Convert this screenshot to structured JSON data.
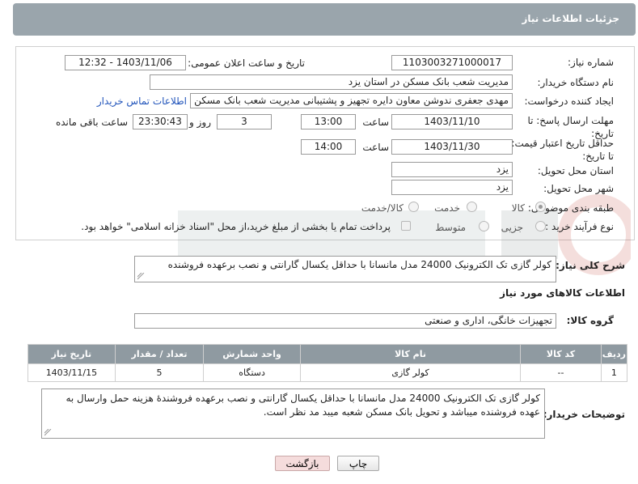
{
  "header": {
    "title": "جزئیات اطلاعات نیاز"
  },
  "fields": {
    "need_number": {
      "label": "شماره نیاز:",
      "value": "1103003271000017"
    },
    "announce": {
      "label": "تاریخ و ساعت اعلان عمومی:",
      "value": "1403/11/06 - 12:32"
    },
    "buyer": {
      "label": "نام دستگاه خریدار:",
      "value": "مدیریت شعب بانک مسکن در استان یزد"
    },
    "creator": {
      "label": "ایجاد کننده درخواست:",
      "value": "مهدی  جعفری ندوشن معاون دایره تجهیز و پشتیبانی مدیریت شعب بانک مسکن",
      "link": "اطلاعات تماس خریدار"
    },
    "deadline": {
      "label": "مهلت ارسال پاسخ: تا تاریخ:",
      "date": "1403/11/10",
      "time_label": "ساعت",
      "time": "13:00",
      "days": "3",
      "days_label": "روز و",
      "remaining": "23:30:43",
      "remaining_label": "ساعت باقی مانده"
    },
    "validity": {
      "label": "حداقل تاریخ اعتبار قیمت: تا تاریخ:",
      "date": "1403/11/30",
      "time_label": "ساعت",
      "time": "14:00"
    },
    "province": {
      "label": "استان محل تحویل:",
      "value": "یزد"
    },
    "city": {
      "label": "شهر محل تحویل:",
      "value": "یزد"
    },
    "category": {
      "label": "طبقه بندی موضوعی:",
      "options": [
        "کالا",
        "خدمت",
        "کالا/خدمت"
      ],
      "selected": "کالا"
    },
    "process": {
      "label": "نوع فرآیند خرید :",
      "options": [
        "جزیی",
        "متوسط"
      ],
      "payment_note": "پرداخت تمام یا بخشی از مبلغ خرید،از محل \"اسناد خزانه اسلامی\" خواهد بود."
    }
  },
  "summary": {
    "label": "شرح کلی نیاز:",
    "value": "کولر گازی تک الکترونیک 24000 مدل مانسانا با حداقل یکسال گارانتی و نصب برعهده فروشنده"
  },
  "goods_section": {
    "title": "اطلاعات کالاهای مورد نیاز"
  },
  "goods_group": {
    "label": "گروه کالا:",
    "value": "تجهیزات خانگی، اداری و صنعتی"
  },
  "table": {
    "headers": [
      "ردیف",
      "کد کالا",
      "نام کالا",
      "واحد شمارش",
      "تعداد / مقدار",
      "تاریخ نیاز"
    ],
    "rows": [
      [
        "1",
        "--",
        "کولر گازی",
        "دستگاه",
        "5",
        "1403/11/15"
      ]
    ]
  },
  "buyer_notes": {
    "label": "توضیحات خریدار:",
    "value": "کولر گازی تک الکترونیک 24000 مدل مانسانا با حداقل یکسال گارانتی و نصب برعهده فروشندهٔ هزینه حمل وارسال به عهده فروشنده میباشد و تحویل بانک مسکن شعبه میبد مد نظر است."
  },
  "buttons": {
    "print": "چاپ",
    "back": "بازگشت"
  },
  "colors": {
    "header_bg": "#9aa5ac",
    "table_header_bg": "#8f9aa1",
    "back_btn_bg": "#f5dcdc",
    "link": "#2255bb"
  }
}
